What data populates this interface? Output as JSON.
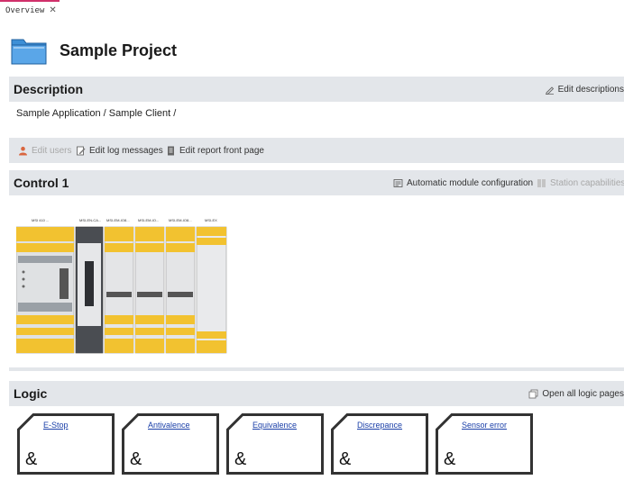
{
  "tab": {
    "label": "Overview",
    "close": "✕"
  },
  "project": {
    "title": "Sample Project"
  },
  "description": {
    "heading": "Description",
    "edit_label": "Edit descriptions",
    "text": "Sample Application / Sample Client /"
  },
  "actions": {
    "edit_users": "Edit users",
    "edit_log": "Edit log messages",
    "edit_report": "Edit report front page"
  },
  "control": {
    "heading": "Control 1",
    "auto_config": "Automatic module configuration",
    "station_caps": "Station capabilities",
    "modules": [
      "MSI 410 ...",
      "MSI-EN-CA...",
      "MSI-EM-IO8...",
      "MSI-EM-IO...",
      "MSI-EM-IO8...",
      "MSI-EX"
    ]
  },
  "logic": {
    "heading": "Logic",
    "open_all": "Open all logic pages",
    "pages": [
      {
        "name": "E-Stop",
        "symbol": "&"
      },
      {
        "name": "Antivalence",
        "symbol": "&"
      },
      {
        "name": "Equivalence",
        "symbol": "&"
      },
      {
        "name": "Discrepance",
        "symbol": "&"
      },
      {
        "name": "Sensor error",
        "symbol": "&"
      }
    ]
  },
  "colors": {
    "accent": "#d0306a",
    "bar": "#e3e6ea",
    "module_yellow": "#f2c230",
    "module_dark": "#4a4d52",
    "link": "#1a3fa8"
  }
}
